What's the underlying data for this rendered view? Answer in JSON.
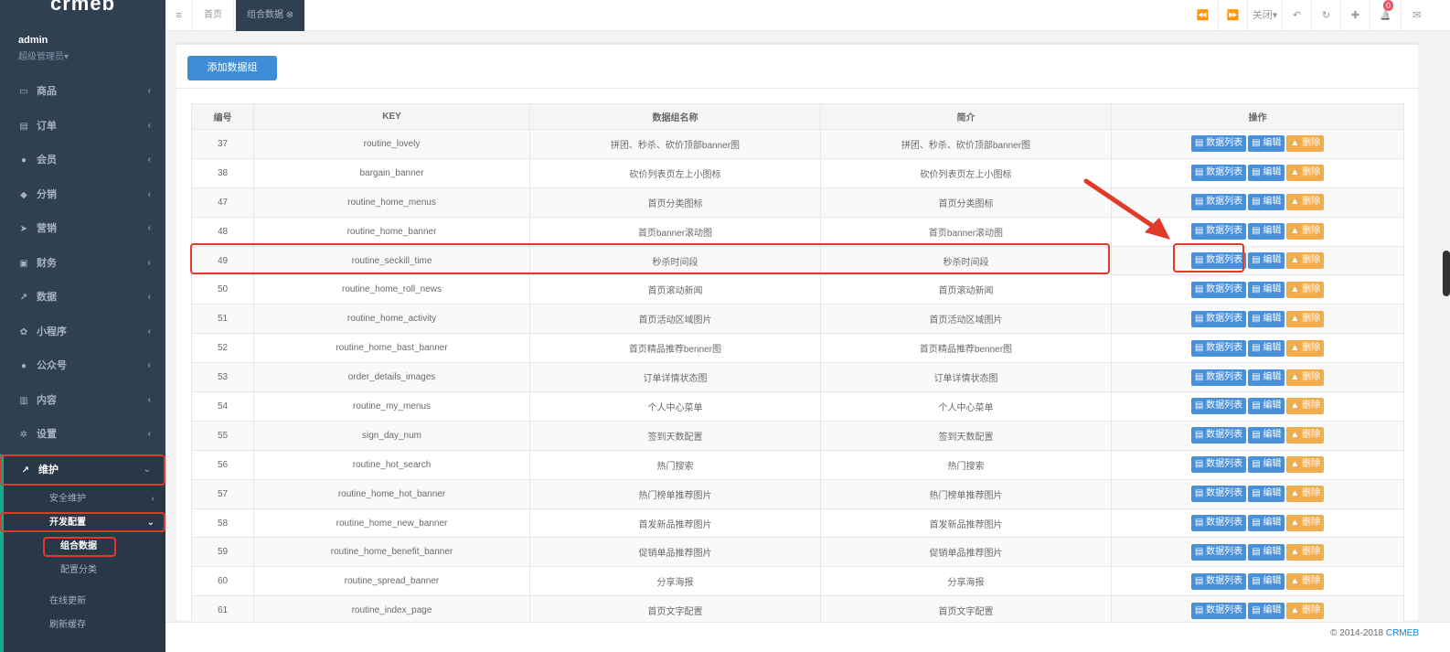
{
  "sidebar": {
    "logo": "crmeb",
    "user": "admin",
    "role": "超级管理员▾",
    "menu": [
      {
        "label": "商品",
        "icon": "▭"
      },
      {
        "label": "订单",
        "icon": "▤"
      },
      {
        "label": "会员",
        "icon": "●"
      },
      {
        "label": "分销",
        "icon": "◆"
      },
      {
        "label": "营销",
        "icon": "➤"
      },
      {
        "label": "财务",
        "icon": "▣"
      },
      {
        "label": "数据",
        "icon": "↗"
      },
      {
        "label": "小程序",
        "icon": "✿"
      },
      {
        "label": "公众号",
        "icon": "●"
      },
      {
        "label": "内容",
        "icon": "▥"
      },
      {
        "label": "设置",
        "icon": "✲"
      },
      {
        "label": "维护",
        "icon": "↗"
      }
    ],
    "sub": {
      "security": "安全维护",
      "dev": "开发配置",
      "combo": "组合数据",
      "config_cat": "配置分类",
      "online_update": "在线更新",
      "refresh_cache": "刷新缓存"
    },
    "arrow": "‹",
    "arrow_down": "⌄"
  },
  "topbar": {
    "menu_icon": "≡",
    "tab_home": "首页",
    "tab_combo": "组合数据 ⊗",
    "back": "⏪",
    "forward": "⏩",
    "close": "关闭▾",
    "undo": "↶",
    "refresh": "↻",
    "fullscreen": "✚",
    "bell": "🔔",
    "bell_count": "0",
    "msg": "✉"
  },
  "main": {
    "add_button": "添加数据组",
    "columns": [
      "编号",
      "KEY",
      "数据组名称",
      "简介",
      "操作"
    ],
    "actions": {
      "list": "▤ 数据列表",
      "edit": "▤ 编辑",
      "delete": "▲ 删除"
    },
    "rows": [
      {
        "id": "37",
        "key": "routine_lovely",
        "name": "拼团、秒杀、砍价顶部banner图",
        "desc": "拼团、秒杀、砍价顶部banner图"
      },
      {
        "id": "38",
        "key": "bargain_banner",
        "name": "砍价列表页左上小图标",
        "desc": "砍价列表页左上小图标"
      },
      {
        "id": "47",
        "key": "routine_home_menus",
        "name": "首页分类图标",
        "desc": "首页分类图标"
      },
      {
        "id": "48",
        "key": "routine_home_banner",
        "name": "首页banner滚动图",
        "desc": "首页banner滚动图"
      },
      {
        "id": "49",
        "key": "routine_seckill_time",
        "name": "秒杀时间段",
        "desc": "秒杀时间段"
      },
      {
        "id": "50",
        "key": "routine_home_roll_news",
        "name": "首页滚动新闻",
        "desc": "首页滚动新闻"
      },
      {
        "id": "51",
        "key": "routine_home_activity",
        "name": "首页活动区域图片",
        "desc": "首页活动区域图片"
      },
      {
        "id": "52",
        "key": "routine_home_bast_banner",
        "name": "首页精品推荐benner图",
        "desc": "首页精品推荐benner图"
      },
      {
        "id": "53",
        "key": "order_details_images",
        "name": "订单详情状态图",
        "desc": "订单详情状态图"
      },
      {
        "id": "54",
        "key": "routine_my_menus",
        "name": "个人中心菜单",
        "desc": "个人中心菜单"
      },
      {
        "id": "55",
        "key": "sign_day_num",
        "name": "签到天数配置",
        "desc": "签到天数配置"
      },
      {
        "id": "56",
        "key": "routine_hot_search",
        "name": "热门搜索",
        "desc": "热门搜索"
      },
      {
        "id": "57",
        "key": "routine_home_hot_banner",
        "name": "热门榜单推荐图片",
        "desc": "热门榜单推荐图片"
      },
      {
        "id": "58",
        "key": "routine_home_new_banner",
        "name": "首发新品推荐图片",
        "desc": "首发新品推荐图片"
      },
      {
        "id": "59",
        "key": "routine_home_benefit_banner",
        "name": "促销单品推荐图片",
        "desc": "促销单品推荐图片"
      },
      {
        "id": "60",
        "key": "routine_spread_banner",
        "name": "分享海报",
        "desc": "分享海报"
      },
      {
        "id": "61",
        "key": "routine_index_page",
        "name": "首页文字配置",
        "desc": "首页文字配置"
      }
    ]
  },
  "footer": {
    "copyright": "© 2014-2018 ",
    "brand": "CRMEB"
  },
  "colors": {
    "sidebar_bg": "#2f4050",
    "primary": "#3f8dd6",
    "danger": "#f0ad4e",
    "annotation": "#e03a2b"
  }
}
